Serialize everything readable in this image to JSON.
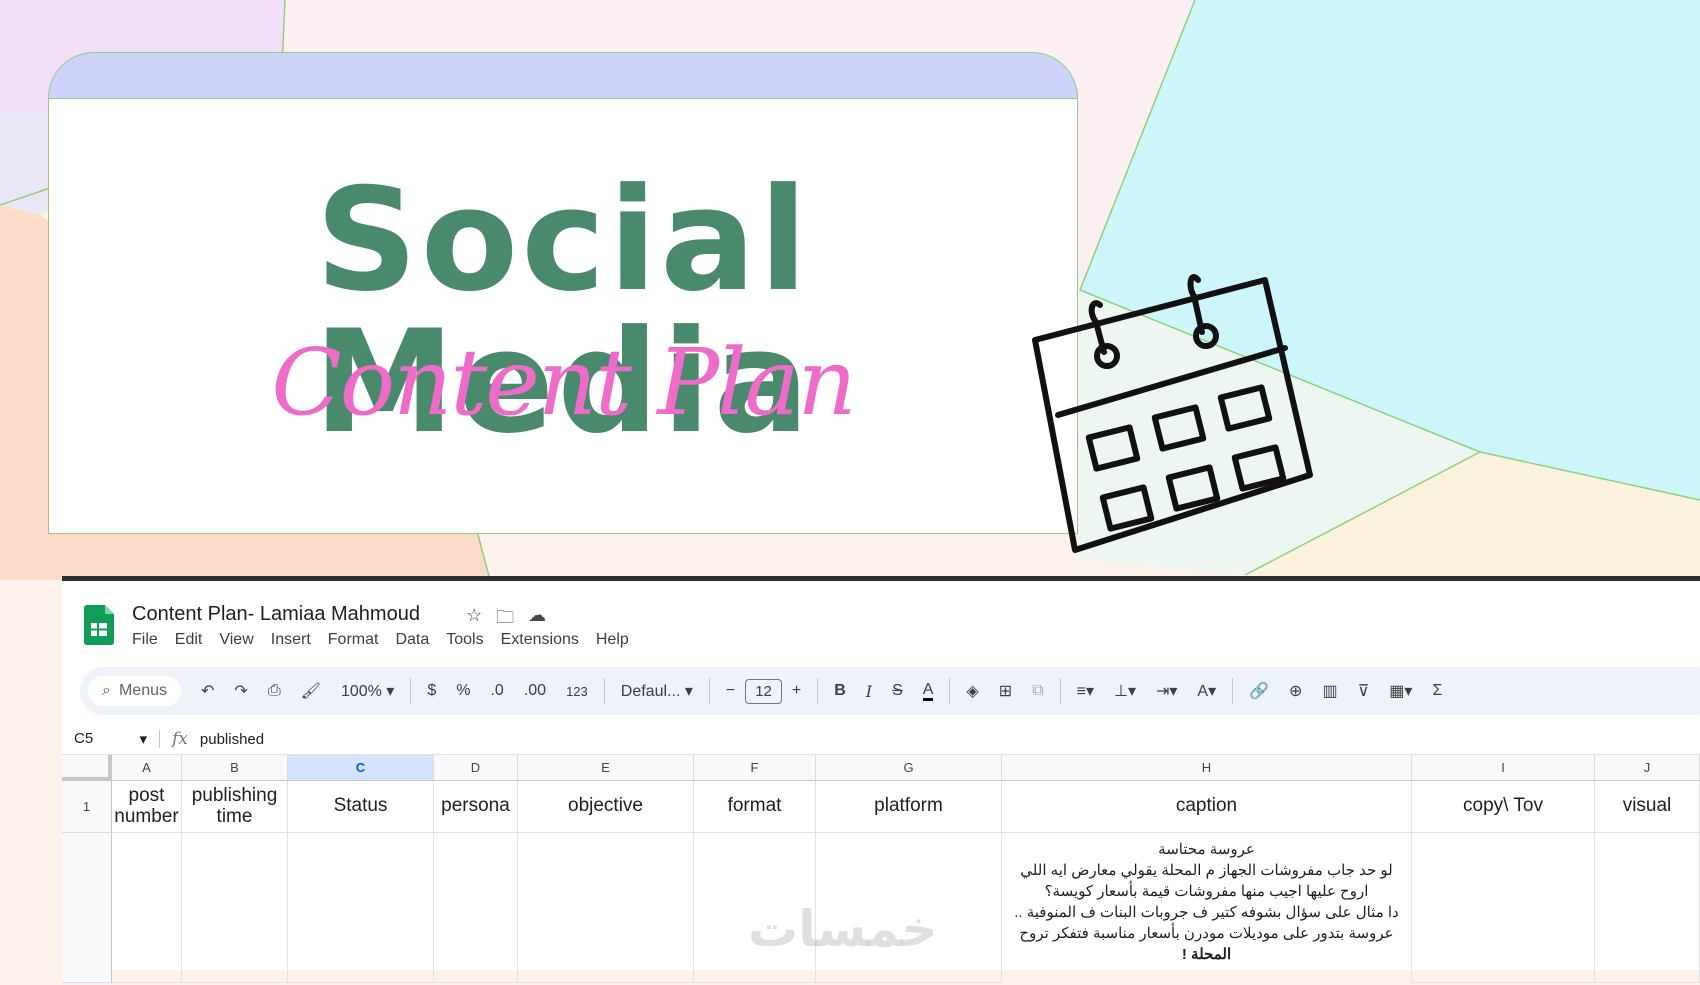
{
  "banner": {
    "headline": "Social Media",
    "script_title": "Content Plan"
  },
  "spreadsheet": {
    "doc_title": "Content Plan- Lamiaa Mahmoud",
    "title_icons": [
      "star-icon",
      "move-to-folder-icon",
      "cloud-saved-icon"
    ],
    "menu": [
      "File",
      "Edit",
      "View",
      "Insert",
      "Format",
      "Data",
      "Tools",
      "Extensions",
      "Help"
    ],
    "toolbar": {
      "search_label": "Menus",
      "zoom": "100%",
      "currency": "$",
      "percent": "%",
      "decrease_decimal": ".0",
      "increase_decimal": ".00",
      "number_format": "123",
      "font": "Defaul...",
      "font_size": "12",
      "minus": "−",
      "plus": "+",
      "bold": "B",
      "italic": "I",
      "strike": "S",
      "text_color": "A",
      "sum": "Σ"
    },
    "name_box": "C5",
    "formula_value": "published",
    "columns": [
      "A",
      "B",
      "C",
      "D",
      "E",
      "F",
      "G",
      "H",
      "I",
      "J"
    ],
    "selected_column": "C",
    "row_numbers": [
      "1"
    ],
    "header_row": {
      "A": "post number",
      "B": "publishing time",
      "C": "Status",
      "D": "persona",
      "E": "objective",
      "F": "format",
      "G": "platform",
      "H": "caption",
      "I": "copy\\ Tov",
      "J": "visual"
    },
    "caption_lines": [
      "عروسة محتاسة",
      "لو حد جاب مفروشات الجهاز م المحلة يقولي معارض ايه اللي",
      "اروح عليها اجيب منها مفروشات قيمة بأسعار كويسة؟",
      "دا مثال على سؤال بشوفه كتير ف جروبات البنات ف المنوفية ..",
      "عروسة بتدور على موديلات مودرن بأسعار مناسبة فتفكر تروح",
      "المحلة !"
    ]
  },
  "watermark": "خمسات",
  "colors": {
    "headline": "#4a8a6c",
    "script": "#ee6bc9",
    "banner_tab": "#cdd3fb",
    "banner_border": "#8fd07a",
    "sheets_green": "#0f9d58",
    "selected_column": "#d3e3fd"
  }
}
